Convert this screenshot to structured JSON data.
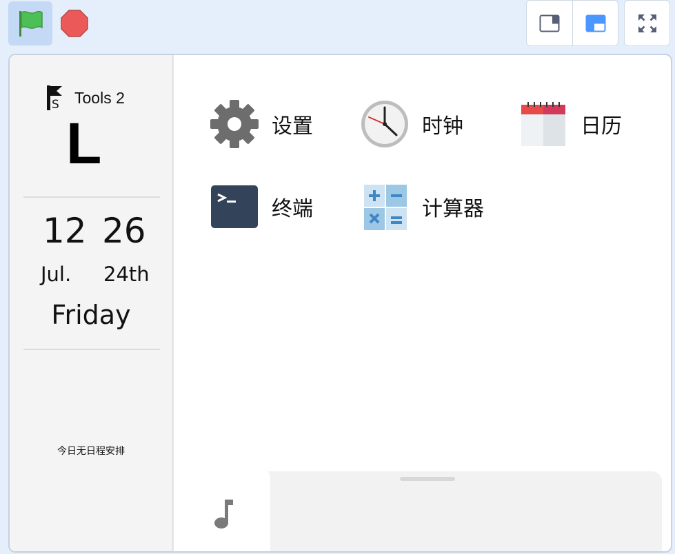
{
  "toolbar": {
    "green_flag_icon": "green-flag-icon",
    "stop_icon": "stop-sign-icon",
    "layout_small_icon": "small-stage-layout-icon",
    "layout_normal_icon": "normal-stage-layout-icon",
    "fullscreen_icon": "fullscreen-icon"
  },
  "sidebar": {
    "tools_label": "Tools 2",
    "big_letter": "L",
    "time_hours": "12",
    "time_minutes": "26",
    "date_month": "Jul.",
    "date_day": "24th",
    "weekday": "Friday",
    "schedule_text": "今日无日程安排"
  },
  "apps": [
    {
      "label": "设置",
      "icon": "gear-icon"
    },
    {
      "label": "时钟",
      "icon": "clock-icon"
    },
    {
      "label": "日历",
      "icon": "calendar-icon"
    },
    {
      "label": "终端",
      "icon": "terminal-icon"
    },
    {
      "label": "计算器",
      "icon": "calculator-icon"
    }
  ],
  "dock": {
    "music_icon": "music-note-icon"
  },
  "colors": {
    "background": "#e5effc",
    "flag_button_active": "#c3d9f6",
    "flag_green": "#4cbf56",
    "stop_red": "#ec5959",
    "accent_blue": "#4c97ff"
  }
}
